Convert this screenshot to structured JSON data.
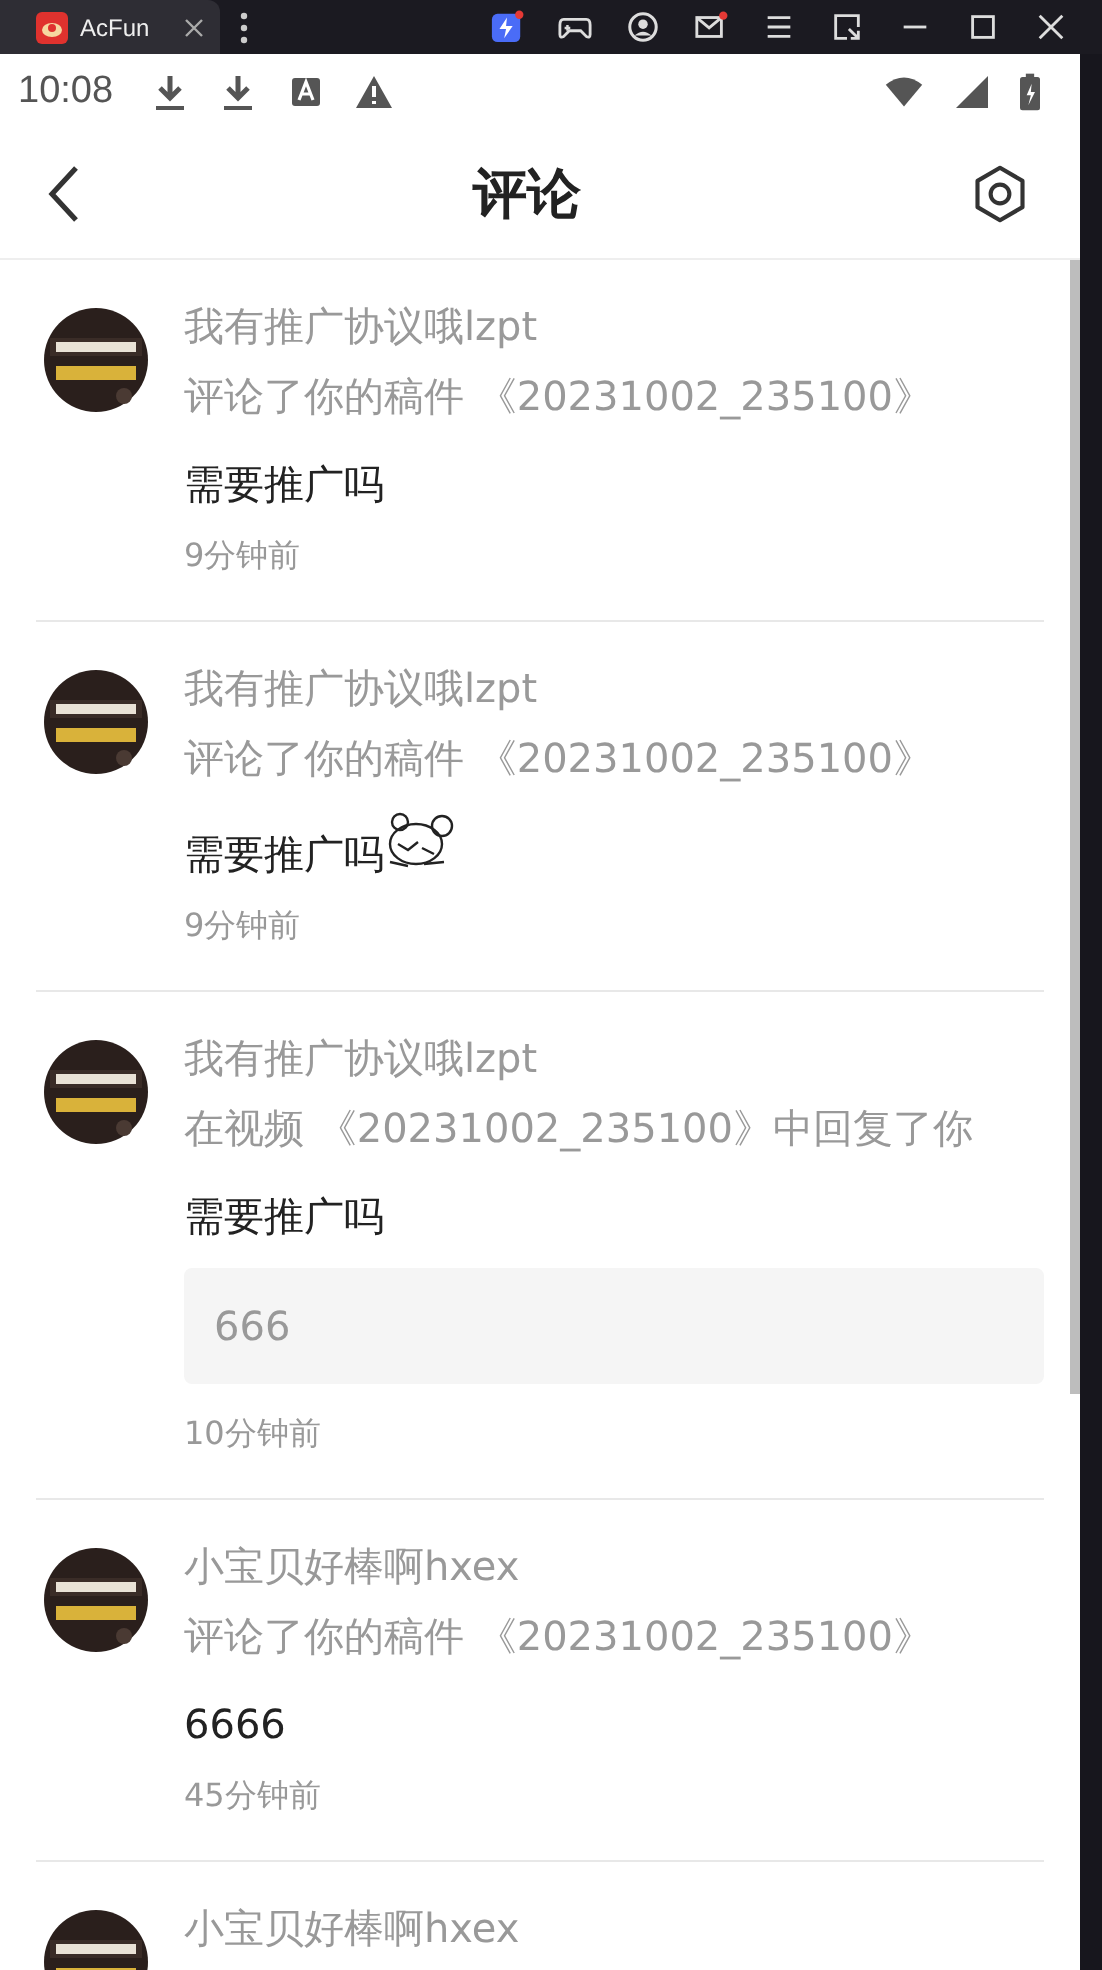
{
  "emulator_tab": {
    "title": "AcFun"
  },
  "status_bar": {
    "time": "10:08"
  },
  "header": {
    "title": "评论"
  },
  "comments": [
    {
      "user": "我有推广协议哦lzpt",
      "action": "评论了你的稿件 《20231002_235100》",
      "content": "需要推广吗",
      "sticker": false,
      "time": "9分钟前"
    },
    {
      "user": "我有推广协议哦lzpt",
      "action": "评论了你的稿件 《20231002_235100》",
      "content": "需要推广吗",
      "sticker": true,
      "time": "9分钟前"
    },
    {
      "user": "我有推广协议哦lzpt",
      "action": "在视频 《20231002_235100》中回复了你",
      "content": "需要推广吗",
      "sticker": false,
      "quote": "666",
      "time": "10分钟前"
    },
    {
      "user": "小宝贝好棒啊hxex",
      "action": "评论了你的稿件 《20231002_235100》",
      "content": "6666",
      "sticker": false,
      "time": "45分钟前"
    },
    {
      "user": "小宝贝好棒啊hxex"
    }
  ]
}
